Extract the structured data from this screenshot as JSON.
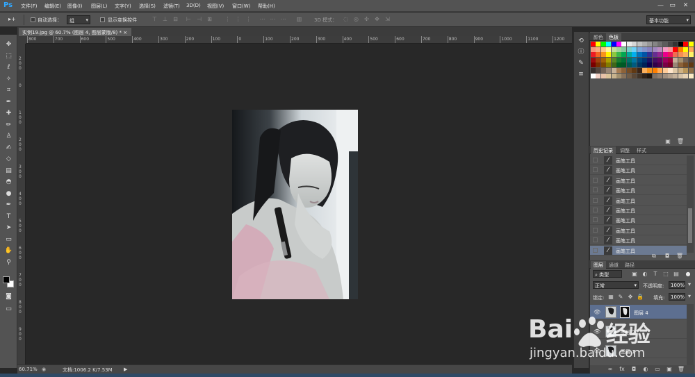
{
  "app": {
    "logo": "Ps",
    "window_buttons": [
      "—",
      "▭",
      "✕"
    ]
  },
  "menu": [
    "文件(F)",
    "编辑(E)",
    "图像(I)",
    "图层(L)",
    "文字(Y)",
    "选择(S)",
    "滤镜(T)",
    "3D(D)",
    "视图(V)",
    "窗口(W)",
    "帮助(H)"
  ],
  "options": {
    "tool_glyph": "▸+",
    "auto_select_label": "自动选择：",
    "auto_select_value": "组",
    "show_transform_label": "显示变换控件",
    "mode_3d_label": "3D 模式：",
    "workspace": "基本功能"
  },
  "document": {
    "tab_title": "实例19.jpg @ 60.7% (图层 4, 图层蒙版/8) *",
    "close": "×"
  },
  "rulers": {
    "h_ticks": [
      "800",
      "700",
      "600",
      "500",
      "400",
      "300",
      "200",
      "100",
      "0",
      "100",
      "200",
      "300",
      "400",
      "500",
      "600",
      "700",
      "800",
      "900",
      "1000",
      "1100",
      "1200"
    ],
    "v_ticks": [
      "200",
      "0",
      "100",
      "200",
      "300",
      "400",
      "500",
      "600",
      "700",
      "800",
      "900"
    ]
  },
  "status": {
    "zoom": "60.71%",
    "doc_info": "文档:1006.2 K/7.53M"
  },
  "tools": [
    "move-tool",
    "marquee-tool",
    "lasso-tool",
    "quick-select-tool",
    "crop-tool",
    "eyedropper-tool",
    "healing-tool",
    "brush-tool",
    "stamp-tool",
    "history-brush-tool",
    "eraser-tool",
    "gradient-tool",
    "blur-tool",
    "dodge-tool",
    "pen-tool",
    "type-tool",
    "path-select-tool",
    "shape-tool",
    "hand-tool",
    "zoom-tool"
  ],
  "color_panel": {
    "tabs": [
      "颜色",
      "色板"
    ],
    "active_tab": "色板",
    "swatch_rows": [
      [
        "#ff0000",
        "#ffff00",
        "#00ff00",
        "#00ffff",
        "#0000ff",
        "#ff00ff",
        "#ffffff",
        "#ebebeb",
        "#d6d6d6",
        "#c2c2c2",
        "#adadad",
        "#999999",
        "#858585",
        "#707070",
        "#5c5c5c",
        "#474747",
        "#333333",
        "#000000",
        "#ff0000",
        "#ffff00"
      ],
      [
        "#f7977a",
        "#f9ad81",
        "#fdc68a",
        "#fff79a",
        "#c4df9b",
        "#a3d39c",
        "#82ca9d",
        "#7bcdc8",
        "#6ecff6",
        "#7ea7d8",
        "#8493ca",
        "#8882be",
        "#a187be",
        "#bc8dbf",
        "#f49ac2",
        "#f6989d",
        "#ff0000",
        "#ff7f00",
        "#ffff00",
        "#ffaa55"
      ],
      [
        "#ed1c24",
        "#f26522",
        "#f7941d",
        "#fff200",
        "#8dc73f",
        "#39b54a",
        "#00a651",
        "#00a99d",
        "#00aeef",
        "#0072bc",
        "#0054a6",
        "#2e3192",
        "#662d91",
        "#92278f",
        "#ec008c",
        "#ed145b",
        "#f26c4f",
        "#f68e55",
        "#fbaf5c",
        "#fff467"
      ],
      [
        "#9e0b0f",
        "#a0410d",
        "#a36209",
        "#aba000",
        "#598527",
        "#1a7b30",
        "#007236",
        "#00746b",
        "#0076a3",
        "#004b80",
        "#003471",
        "#1b1464",
        "#440e62",
        "#630460",
        "#9e005d",
        "#9e0039",
        "#c6b198",
        "#a4906e",
        "#736357",
        "#534741"
      ],
      [
        "#790000",
        "#7b2e00",
        "#7d4900",
        "#827b00",
        "#406618",
        "#005e20",
        "#005826",
        "#005952",
        "#005b7f",
        "#003663",
        "#002157",
        "#0d004c",
        "#32004b",
        "#4b0049",
        "#7b0046",
        "#7a0026",
        "#998675",
        "#8c6239",
        "#754c24",
        "#603913"
      ],
      [
        "#362f2d",
        "#534741",
        "#736357",
        "#998675",
        "#c7b299",
        "#a67c52",
        "#8c6239",
        "#754c24",
        "#603913",
        "#3c2415",
        "#fbaf5c",
        "#f7941d",
        "#ff7f00",
        "#ffaa55",
        "#ffcc99",
        "#ffe6cc",
        "#dfc8a6",
        "#cfb284",
        "#b9975b",
        "#8f7048"
      ]
    ]
  },
  "history_panel": {
    "tabs": [
      "历史记录",
      "调整",
      "样式"
    ],
    "active_tab": "历史记录",
    "items": [
      "画笔工具",
      "画笔工具",
      "画笔工具",
      "画笔工具",
      "画笔工具",
      "画笔工具",
      "画笔工具",
      "画笔工具",
      "画笔工具",
      "画笔工具"
    ],
    "selected_index": 9
  },
  "layers_panel": {
    "tabs": [
      "图层",
      "通道",
      "路径"
    ],
    "active_tab": "图层",
    "filter_label": "类型",
    "blend_mode": "正常",
    "opacity_label": "不透明度:",
    "opacity_value": "100%",
    "lock_label": "锁定:",
    "fill_label": "填充:",
    "fill_value": "100%",
    "layers": [
      {
        "name": "图层 4",
        "selected": true,
        "has_mask": true
      },
      {
        "name": "图层 2",
        "selected": false,
        "has_mask": false
      },
      {
        "name": "图层 1",
        "selected": false,
        "has_mask": false
      }
    ]
  },
  "watermark": {
    "brand": "Bai",
    "brand2": "经验",
    "url": "jingyan.baidu.com"
  }
}
